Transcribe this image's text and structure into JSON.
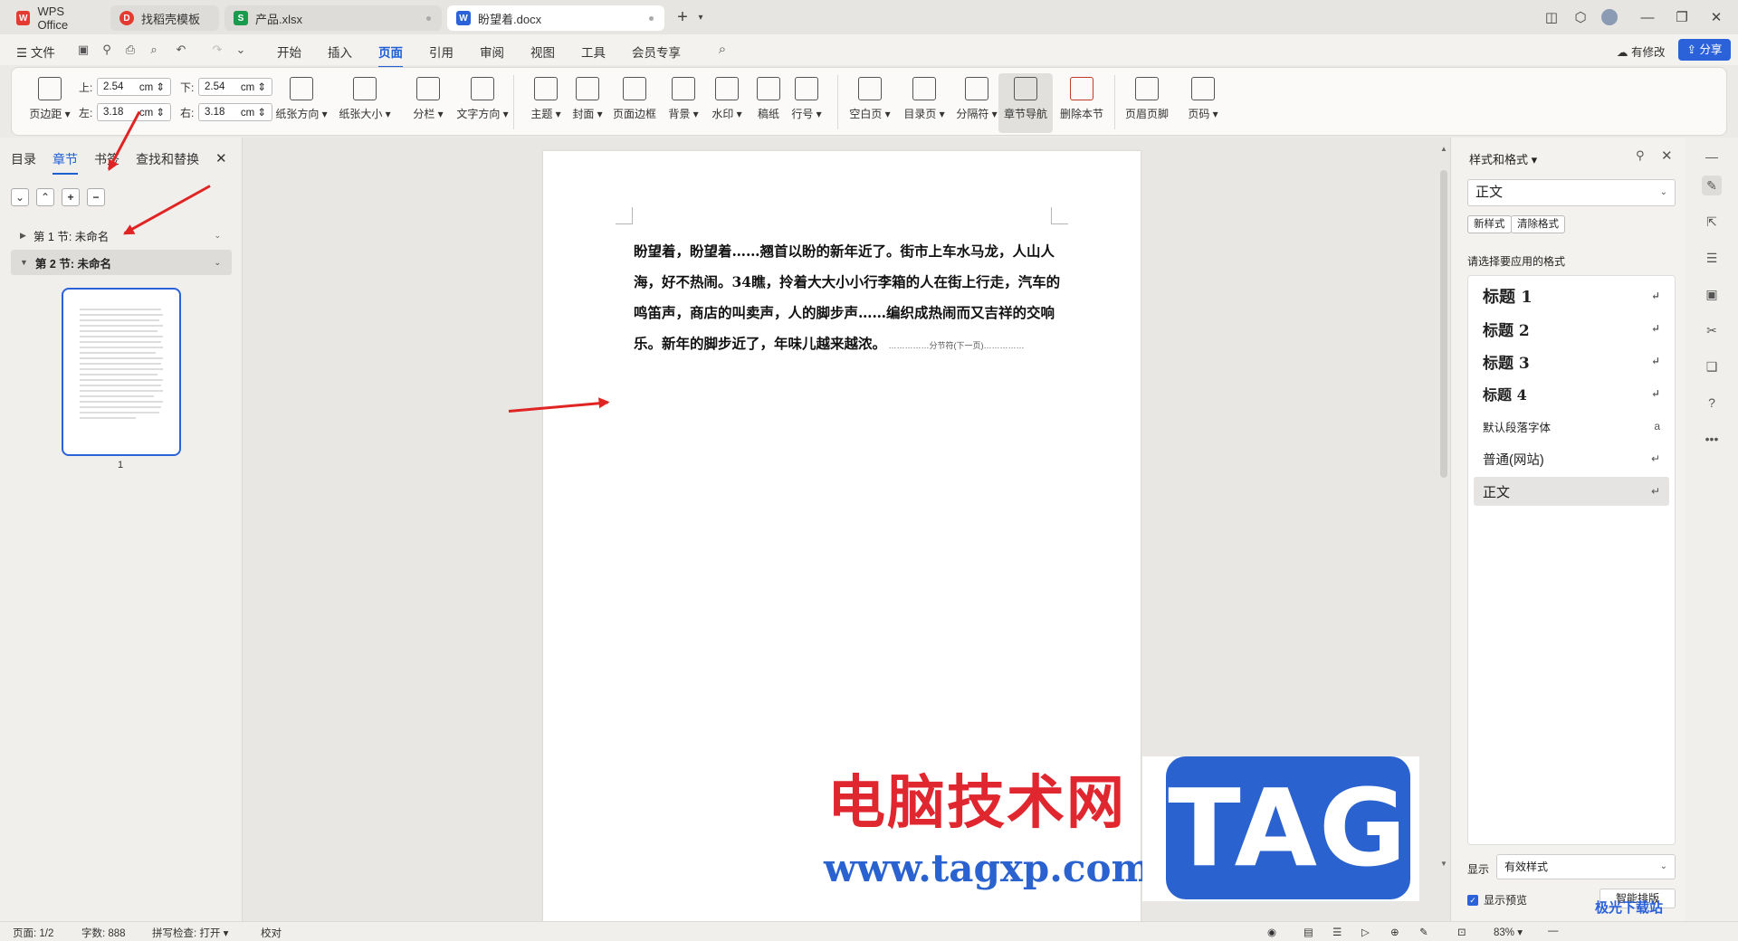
{
  "tabs": [
    {
      "label": "WPS Office"
    },
    {
      "label": "找稻壳模板"
    },
    {
      "label": "产品.xlsx"
    },
    {
      "label": "盼望着.docx"
    }
  ],
  "menu": {
    "file": "文件",
    "items": [
      "开始",
      "插入",
      "页面",
      "引用",
      "审阅",
      "视图",
      "工具",
      "会员专享"
    ],
    "modified": "有修改",
    "share": "分享"
  },
  "ribbon": {
    "margins_label": "页边距",
    "top_label": "上:",
    "top_value": "2.54",
    "bottom_label": "下:",
    "bottom_value": "2.54",
    "left_label": "左:",
    "left_value": "3.18",
    "right_label": "右:",
    "right_value": "3.18",
    "unit": "cm",
    "buttons": [
      "纸张方向",
      "纸张大小",
      "分栏",
      "文字方向",
      "主题",
      "封面",
      "页面边框",
      "背景",
      "水印",
      "稿纸",
      "行号",
      "空白页",
      "目录页",
      "分隔符",
      "章节导航",
      "删除本节",
      "页眉页脚",
      "页码"
    ]
  },
  "leftpanel": {
    "tabs": [
      "目录",
      "章节",
      "书签",
      "查找和替换"
    ],
    "sections": [
      "第 1 节: 未命名",
      "第 2 节: 未命名"
    ],
    "thumb_label": "1"
  },
  "document": {
    "text": "盼望着，盼望着……翘首以盼的新年近了。街市上车水马龙，人山人海，好不热闹。34瞧，拎着大大小小行李箱的人在街上行走，汽车的鸣笛声，商店的叫卖声，人的脚步声……编织成热闹而又吉祥的交响乐。新年的脚步近了，年味儿越来越浓。",
    "section_break": "分节符(下一页)"
  },
  "stylepanel": {
    "title": "样式和格式",
    "current": "正文",
    "new_style": "新样式",
    "clear_format": "清除格式",
    "choose_label": "请选择要应用的格式",
    "styles": [
      "标题 1",
      "标题 2",
      "标题 3",
      "标题 4",
      "默认段落字体",
      "普通(网站)",
      "正文"
    ],
    "show_label": "显示",
    "show_value": "有效样式",
    "preview_label": "显示预览",
    "smart_btn": "智能排版"
  },
  "status": {
    "page": "页面: 1/2",
    "words": "字数: 888",
    "spell": "拼写检查: 打开",
    "proof": "校对",
    "zoom": "83%"
  },
  "watermark": {
    "cn": "电脑技术网",
    "url": "www.tagxp.com",
    "tag": "TAG",
    "corner": "极光下载站"
  }
}
